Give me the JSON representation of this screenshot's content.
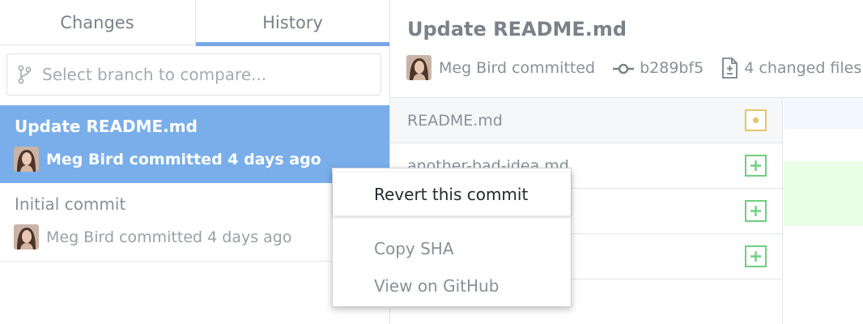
{
  "tabs": {
    "changes": "Changes",
    "history": "History"
  },
  "branch_compare": {
    "placeholder": "Select branch to compare..."
  },
  "commits": [
    {
      "title": "Update README.md",
      "meta": "Meg Bird committed 4 days ago",
      "selected": true
    },
    {
      "title": "Initial commit",
      "meta": "Meg Bird committed 4 days ago",
      "selected": false
    }
  ],
  "detail": {
    "title": "Update README.md",
    "author_text": "Meg Bird committed",
    "sha": "b289bf5",
    "changed_files": "4 changed files"
  },
  "files": [
    {
      "name": "README.md",
      "status": "modified",
      "status_icon": "modified-dot-icon"
    },
    {
      "name": "another-bad-idea.md",
      "status": "added",
      "status_icon": "plus-square-icon"
    },
    {
      "name": "",
      "status": "added",
      "status_icon": "plus-square-icon"
    },
    {
      "name": "",
      "status": "added",
      "status_icon": "plus-square-icon"
    }
  ],
  "context_menu": {
    "items": [
      "Revert this commit",
      "Copy SHA",
      "View on GitHub"
    ]
  },
  "colors": {
    "selected_row": "#79aeea",
    "tab_underline": "#79a8e8",
    "modified": "#e5c46b",
    "added": "#6fcf7f"
  }
}
